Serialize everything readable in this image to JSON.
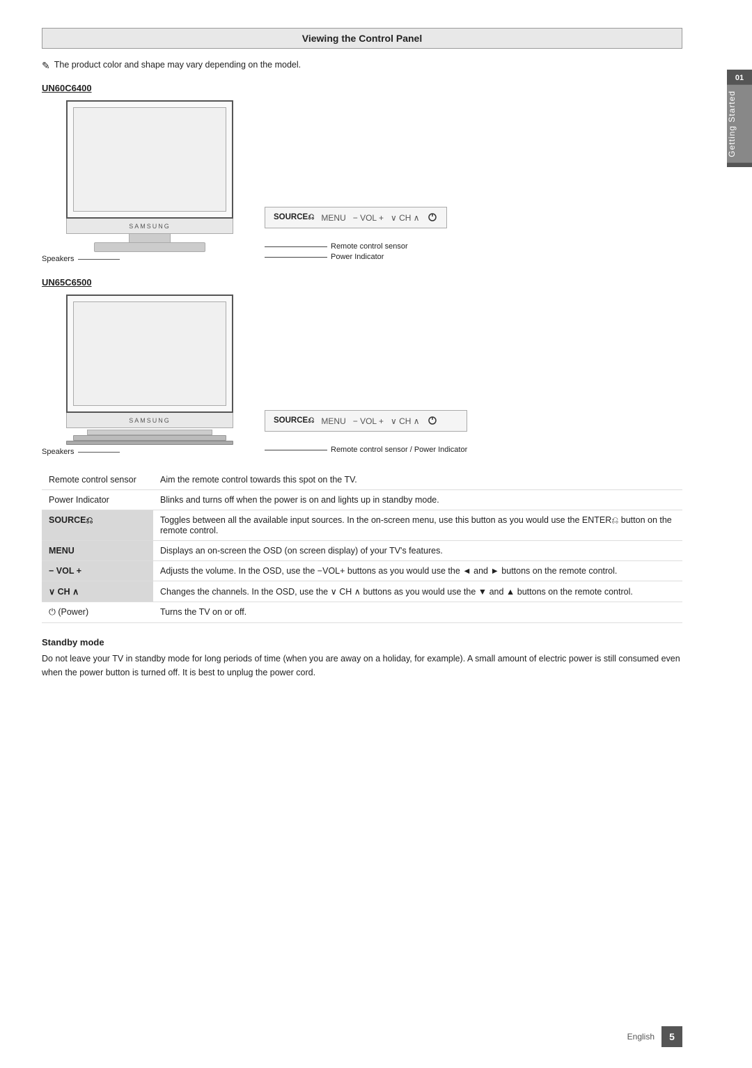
{
  "page": {
    "title": "Viewing the Control Panel",
    "note": "The product color and shape may vary depending on the model.",
    "model1": {
      "id": "UN60C6400",
      "speaker_label": "Speakers",
      "sensor_label1": "Remote control sensor",
      "sensor_label2": "Power Indicator",
      "control_bar": "SOURCE⎌  MENU  − VOL +   ∨ CH ∧   ⏻"
    },
    "model2": {
      "id": "UN65C6500",
      "speaker_label": "Speakers",
      "sensor_label1": "Remote control sensor / Power Indicator",
      "control_bar": "SOURCE⎌  MENU  − VOL +   ∨ CH ∧   ⏻"
    },
    "table": {
      "rows": [
        {
          "label": "Remote control sensor",
          "desc": "Aim the remote control towards this spot on the TV.",
          "shaded": false
        },
        {
          "label": "Power Indicator",
          "desc": "Blinks and turns off when the power is on and lights up in standby mode.",
          "shaded": false
        },
        {
          "label": "SOURCE⎌",
          "desc": "Toggles between all the available input sources. In the on-screen menu, use this button as you would use the ENTER⎌ button on the remote control.",
          "shaded": true
        },
        {
          "label": "MENU",
          "desc": "Displays an on-screen the OSD (on screen display) of your TV's features.",
          "shaded": true
        },
        {
          "label": "− VOL +",
          "desc": "Adjusts the volume. In the OSD, use the −VOL+ buttons as you would use the ◄ and ► buttons on the remote control.",
          "shaded": true
        },
        {
          "label": "∨ CH ∧",
          "desc": "Changes the channels. In the OSD, use the ∨ CH ∧ buttons as you would use the ▼ and ▲ buttons on the remote control.",
          "shaded": true
        },
        {
          "label": "⏻ (Power)",
          "desc": "Turns the TV on or off.",
          "shaded": false
        }
      ]
    },
    "standby": {
      "heading": "Standby mode",
      "text": "Do not leave your TV in standby mode for long periods of time (when you are away on a holiday, for example). A small amount of electric power is still consumed even when the power button is turned off. It is best to unplug the power cord."
    },
    "footer": {
      "lang": "English",
      "page": "5"
    },
    "side_tab": {
      "number": "01",
      "label": "Getting Started"
    }
  }
}
